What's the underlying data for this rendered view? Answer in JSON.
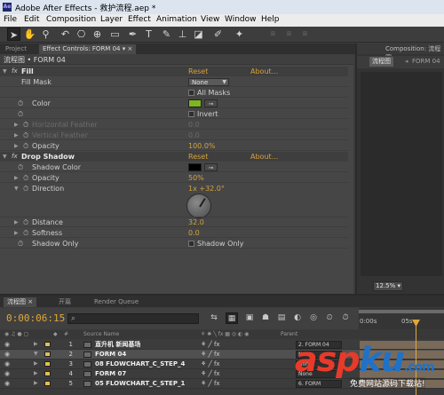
{
  "window": {
    "app_icon": "Ae",
    "title": "Adobe After Effects - 救护流程.aep *"
  },
  "menu": [
    "File",
    "Edit",
    "Composition",
    "Layer",
    "Effect",
    "Animation",
    "View",
    "Window",
    "Help"
  ],
  "toolbar": {
    "icons": [
      "selection-tool-icon",
      "hand-tool-icon",
      "zoom-tool-icon",
      "rotate-tool-icon",
      "camera-tool-icon",
      "pan-behind-tool-icon",
      "mask-tool-icon",
      "pen-tool-icon",
      "text-tool-icon",
      "brush-tool-icon",
      "stamp-tool-icon",
      "eraser-tool-icon",
      "roto-brush-icon",
      "puppet-tool-icon"
    ]
  },
  "panel_tabs": {
    "project": "Project",
    "effect_controls": "Effect Controls: FORM 04",
    "composition": "Composition: 流程图"
  },
  "effect_controls": {
    "breadcrumb": "流程图 • FORM 04",
    "fill": {
      "name": "Fill",
      "reset": "Reset",
      "about": "About...",
      "fill_mask_label": "Fill Mask",
      "fill_mask_value": "None",
      "all_masks": "All Masks",
      "color_label": "Color",
      "color_value": "#7fb522",
      "invert": "Invert",
      "h_feather_label": "Horizontal Feather",
      "h_feather_value": "0.0",
      "v_feather_label": "Vertical Feather",
      "v_feather_value": "0.0",
      "opacity_label": "Opacity",
      "opacity_value": "100.0%"
    },
    "drop_shadow": {
      "name": "Drop Shadow",
      "reset": "Reset",
      "about": "About...",
      "shadow_color_label": "Shadow Color",
      "shadow_color_value": "#000000",
      "opacity_label": "Opacity",
      "opacity_value": "50%",
      "direction_label": "Direction",
      "direction_value": "1x +32.0°",
      "distance_label": "Distance",
      "distance_value": "32.0",
      "softness_label": "Softness",
      "softness_value": "0.0",
      "shadow_only_label": "Shadow Only",
      "shadow_only_check": "Shadow Only"
    }
  },
  "composition": {
    "breadcrumb_active": "流程图",
    "breadcrumb_next": "FORM 04",
    "zoom": "12.5%"
  },
  "timeline": {
    "tabs": [
      "流程图",
      "开篇",
      "Render Queue"
    ],
    "timecode": "0:00:06:15",
    "ruler": [
      "0:00s",
      "05s"
    ],
    "col_source": "Source Name",
    "col_parent": "Parent",
    "layers": [
      {
        "num": "1",
        "name": "直升机 新闻基场",
        "parent": "2. FORM 04"
      },
      {
        "num": "2",
        "name": "FORM 04",
        "parent": "None"
      },
      {
        "num": "3",
        "name": "08 FLOWCHART_C_STEP_4",
        "parent": "None"
      },
      {
        "num": "4",
        "name": "FORM 07",
        "parent": "None"
      },
      {
        "num": "5",
        "name": "05 FLOWCHART_C_STEP_1",
        "parent": "6. FORM"
      }
    ]
  },
  "watermark": {
    "brand_a": "asp",
    "brand_b": "ku",
    "brand_dom": ".com",
    "tagline": "免费网站源码下载站!"
  }
}
